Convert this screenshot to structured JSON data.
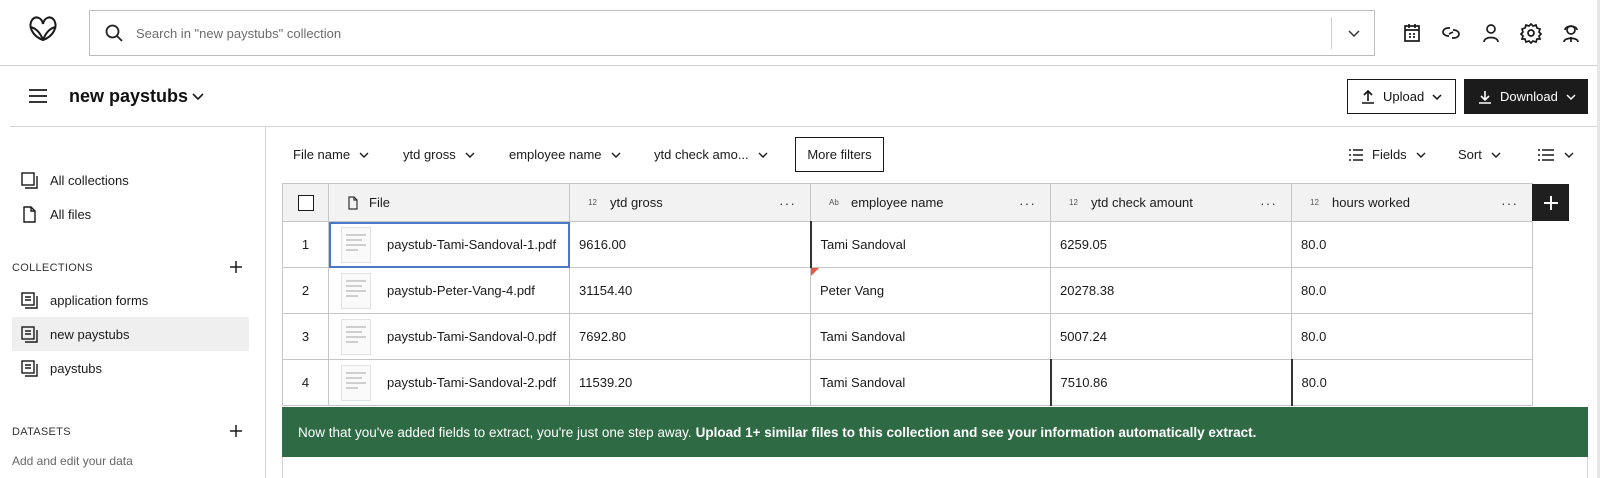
{
  "search": {
    "placeholder": "Search in \"new paystubs\" collection"
  },
  "top_icons": [
    "calendar-icon",
    "link-icon",
    "user-icon",
    "gear-icon",
    "support-agent-icon"
  ],
  "header": {
    "collection_title": "new paystubs",
    "upload_label": "Upload",
    "download_label": "Download"
  },
  "sidebar": {
    "all_collections": "All collections",
    "all_files": "All files",
    "collections_heading": "COLLECTIONS",
    "collections": [
      {
        "label": "application forms",
        "active": false
      },
      {
        "label": "new paystubs",
        "active": true
      },
      {
        "label": "paystubs",
        "active": false
      }
    ],
    "datasets_heading": "DATASETS",
    "datasets_hint": "Add and edit your data"
  },
  "filters": {
    "items": [
      "File name",
      "ytd gross",
      "employee name",
      "ytd check amo..."
    ],
    "more_filters": "More filters",
    "fields_label": "Fields",
    "sort_label": "Sort"
  },
  "table": {
    "columns": [
      {
        "label": "File",
        "type": ""
      },
      {
        "label": "ytd gross",
        "type": "12"
      },
      {
        "label": "employee name",
        "type": "Ab"
      },
      {
        "label": "ytd check amount",
        "type": "12"
      },
      {
        "label": "hours worked",
        "type": "12"
      }
    ],
    "rows": [
      {
        "n": "1",
        "file": "paystub-Tami-Sandoval-1.pdf",
        "ytd_gross": "9616.00",
        "employee": "Tami Sandoval",
        "ytd_check": "6259.05",
        "hours": "80.0"
      },
      {
        "n": "2",
        "file": "paystub-Peter-Vang-4.pdf",
        "ytd_gross": "31154.40",
        "employee": "Peter Vang",
        "ytd_check": "20278.38",
        "hours": "80.0"
      },
      {
        "n": "3",
        "file": "paystub-Tami-Sandoval-0.pdf",
        "ytd_gross": "7692.80",
        "employee": "Tami Sandoval",
        "ytd_check": "5007.24",
        "hours": "80.0"
      },
      {
        "n": "4",
        "file": "paystub-Tami-Sandoval-2.pdf",
        "ytd_gross": "11539.20",
        "employee": "Tami Sandoval",
        "ytd_check": "7510.86",
        "hours": "80.0"
      }
    ]
  },
  "banner": {
    "text": "Now that you've added fields to extract, you're just one step away.",
    "bold_text": "Upload 1+ similar files to this collection and see your information automatically extract."
  },
  "colors": {
    "banner_bg": "#2e6b45",
    "dark_button": "#1b1b1b",
    "selection": "#4a78c8"
  }
}
